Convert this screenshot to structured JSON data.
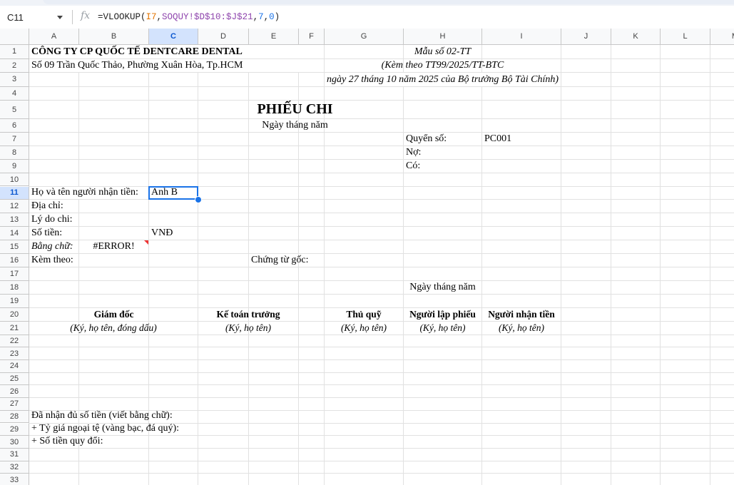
{
  "formula_bar": {
    "name_box": "C11",
    "fx_icon": "fx",
    "formula_parts": [
      "=VLOOKUP(",
      "I7",
      ",",
      "SOQUY!$D$10:$J$21",
      ",",
      "7",
      ",",
      "0",
      ")"
    ]
  },
  "columns": [
    "A",
    "B",
    "C",
    "D",
    "E",
    "F",
    "G",
    "H",
    "I",
    "J",
    "K",
    "L",
    "M"
  ],
  "rows": [
    "1",
    "2",
    "3",
    "4",
    "5",
    "6",
    "7",
    "8",
    "9",
    "10",
    "11",
    "12",
    "13",
    "14",
    "15",
    "16",
    "17",
    "18",
    "19",
    "20",
    "21",
    "22",
    "23",
    "24",
    "25",
    "26",
    "27",
    "28",
    "29",
    "30",
    "31",
    "32",
    "33"
  ],
  "selected_cell": "C11",
  "cells": {
    "A1": "CÔNG TY CP QUỐC TẾ DENTCARE DENTAL",
    "A2": "Số 09 Trần Quốc Thảo, Phường Xuân Hòa, Tp.HCM",
    "H1": "Mẫu số 02-TT",
    "H2": "(Kèm theo TT99/2025/TT-BTC",
    "H3": "ngày 27 tháng 10 năm 2025 của Bộ trưởng Bộ Tài Chính)",
    "A5": "PHIẾU CHI",
    "A6": "Ngày     tháng     năm",
    "H7": "Quyển số:",
    "I7": "PC001",
    "H8": "Nợ:",
    "H9": "Có:",
    "A11": "Họ và tên người nhận tiền:",
    "C11": "Anh B",
    "A12": "Địa chỉ:",
    "A13": "Lý do chi:",
    "A14": "Số tiền:",
    "C14": "VNĐ",
    "A15": "Bằng chữ:",
    "B15": "#ERROR!",
    "A16": "Kèm theo:",
    "E16": "Chứng từ gốc:",
    "H18": "Ngày     tháng     năm",
    "B20": "Giám đốc",
    "D20": "Kế toán trưởng",
    "G20": "Thủ quỹ",
    "H20": "Người lập phiếu",
    "I20": "Người nhận tiền",
    "B21": "(Ký, họ tên, đóng dấu)",
    "D21": "(Ký, họ tên)",
    "G21": "(Ký, họ tên)",
    "H21": "(Ký, họ tên)",
    "I21": "(Ký, họ tên)",
    "A28": "Đã nhận đủ số tiền (viết bằng chữ):",
    "A29": "+ Tỷ giá ngoại tệ (vàng bạc, đá quý):",
    "A30": "+ Số tiền quy đổi:"
  }
}
